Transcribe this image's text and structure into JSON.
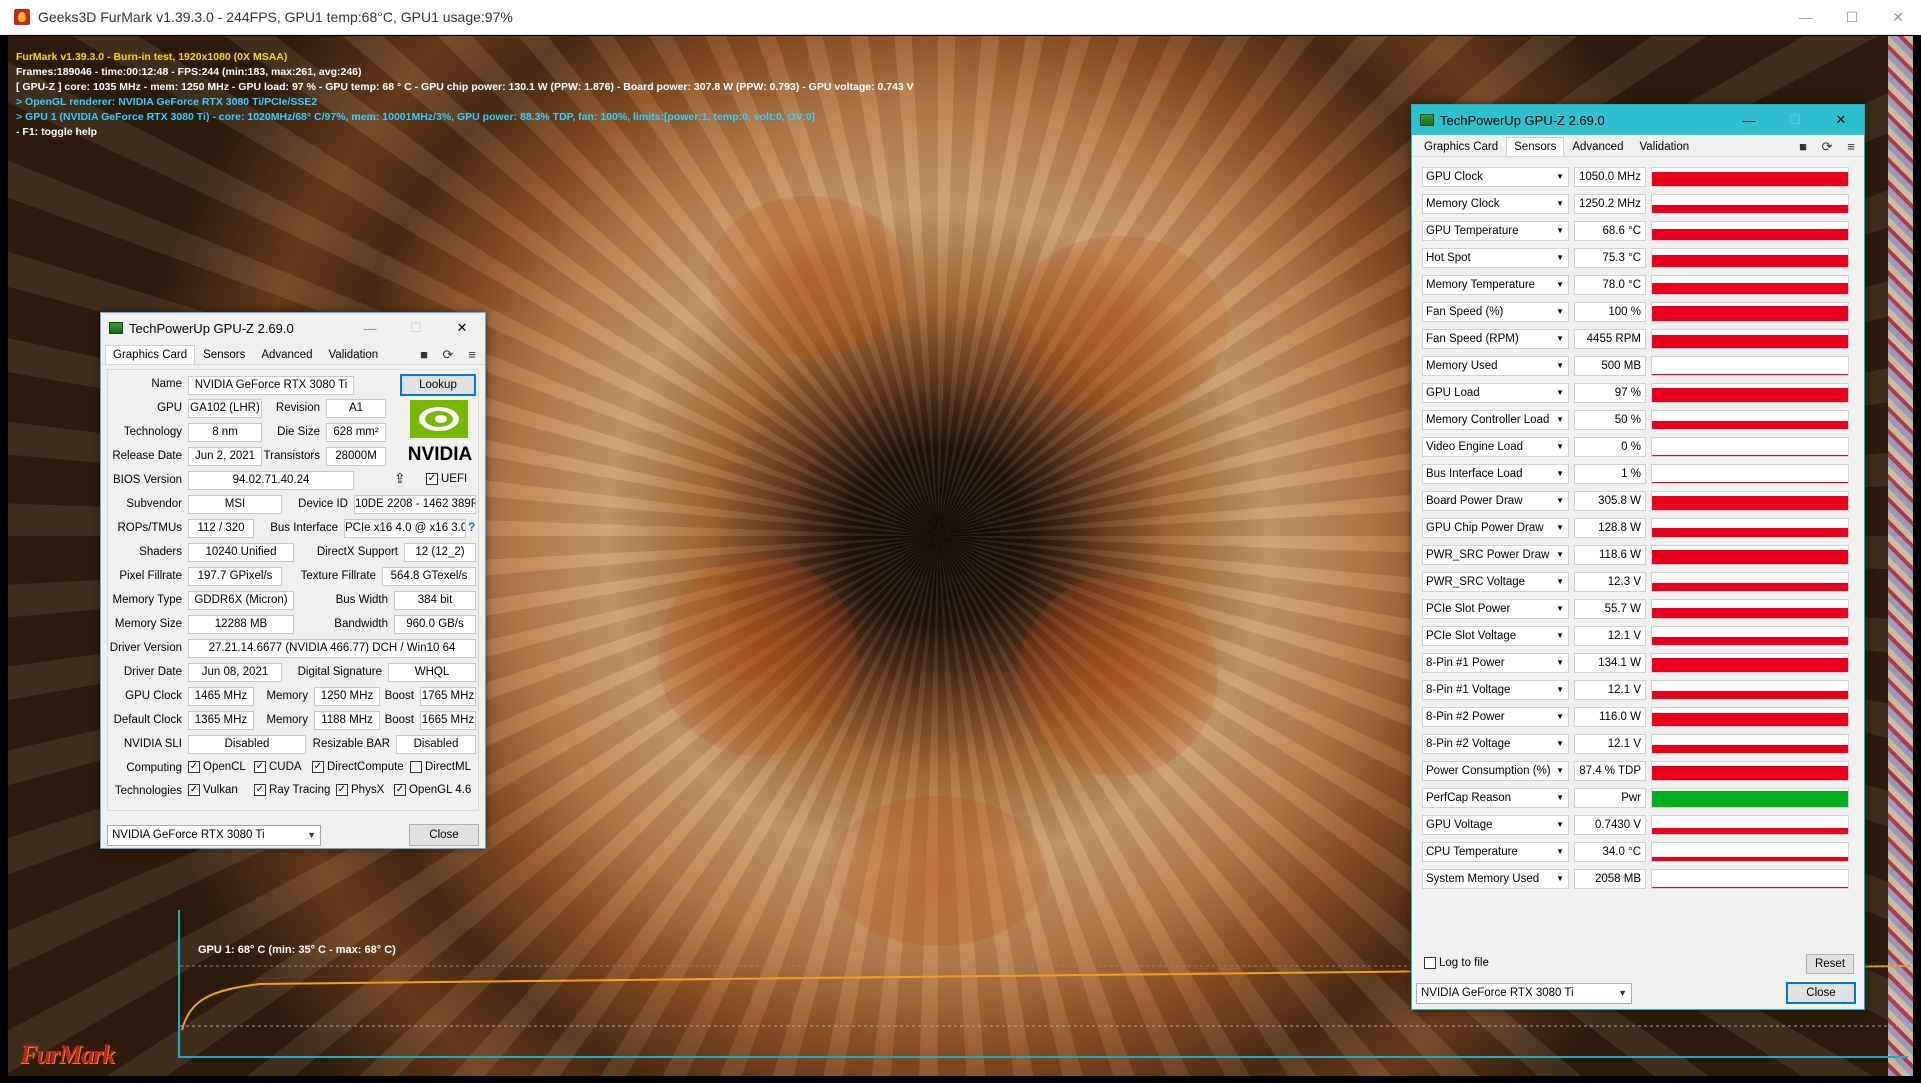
{
  "furmark": {
    "window_title": "Geeks3D FurMark v1.39.3.0 - 244FPS, GPU1 temp:68°C, GPU1 usage:97%",
    "osd": [
      "FurMark v1.39.3.0 - Burn-in test, 1920x1080 (0X MSAA)",
      "Frames:189046 - time:00:12:48 - FPS:244 (min:183, max:261, avg:246)",
      "[ GPU-Z ] core: 1035 MHz - mem: 1250 MHz - GPU load: 97 % - GPU temp: 68 ° C - GPU chip power: 130.1 W (PPW: 1.876) - Board power: 307.8 W (PPW: 0.793) - GPU voltage: 0.743 V",
      "> OpenGL renderer: NVIDIA GeForce RTX 3080 Ti/PCIe/SSE2",
      "> GPU 1 (NVIDIA GeForce RTX 3080 Ti) - core: 1020MHz/68° C/97%, mem: 10001MHz/3%, GPU power: 88.3% TDP, fan: 100%, limits:[power:1, temp:0, volt:0, OV:0]",
      "- F1: toggle help"
    ],
    "graph_label": "GPU 1: 68° C (min: 35° C - max: 68° C)",
    "logo_text": "FurMark"
  },
  "gpuz_card": {
    "title": "TechPowerUp GPU-Z 2.69.0",
    "tabs": [
      "Graphics Card",
      "Sensors",
      "Advanced",
      "Validation"
    ],
    "labels": {
      "name": "Name",
      "gpu": "GPU",
      "revision": "Revision",
      "technology": "Technology",
      "die_size": "Die Size",
      "release_date": "Release Date",
      "transistors": "Transistors",
      "bios_version": "BIOS Version",
      "subvendor": "Subvendor",
      "device_id": "Device ID",
      "rops_tmus": "ROPs/TMUs",
      "bus_interface": "Bus Interface",
      "shaders": "Shaders",
      "directx_support": "DirectX Support",
      "pixel_fillrate": "Pixel Fillrate",
      "texture_fillrate": "Texture Fillrate",
      "memory_type": "Memory Type",
      "bus_width": "Bus Width",
      "memory_size": "Memory Size",
      "bandwidth": "Bandwidth",
      "driver_version": "Driver Version",
      "driver_date": "Driver Date",
      "digital_signature": "Digital Signature",
      "gpu_clock": "GPU Clock",
      "memory": "Memory",
      "boost": "Boost",
      "default_clock": "Default Clock",
      "nvidia_sli": "NVIDIA SLI",
      "resizable_bar": "Resizable BAR",
      "computing": "Computing",
      "technologies": "Technologies"
    },
    "values": {
      "name": "NVIDIA GeForce RTX 3080 Ti",
      "gpu": "GA102 (LHR)",
      "revision": "A1",
      "technology": "8 nm",
      "die_size": "628 mm²",
      "release_date": "Jun 2, 2021",
      "transistors": "28000M",
      "bios_version": "94.02.71.40.24",
      "subvendor": "MSI",
      "device_id": "10DE 2208 - 1462 389F",
      "rops_tmus": "112 / 320",
      "bus_interface": "PCIe x16 4.0 @ x16 3.0",
      "shaders": "10240 Unified",
      "directx_support": "12 (12_2)",
      "pixel_fillrate": "197.7 GPixel/s",
      "texture_fillrate": "564.8 GTexel/s",
      "memory_type": "GDDR6X (Micron)",
      "bus_width": "384 bit",
      "memory_size": "12288 MB",
      "bandwidth": "960.0 GB/s",
      "driver_version": "27.21.14.6677 (NVIDIA 466.77) DCH / Win10 64",
      "driver_date": "Jun 08, 2021",
      "digital_signature": "WHQL",
      "gpu_clock": "1465 MHz",
      "gpu_memory": "1250 MHz",
      "gpu_boost": "1765 MHz",
      "default_clock": "1365 MHz",
      "default_memory": "1188 MHz",
      "default_boost": "1665 MHz",
      "nvidia_sli": "Disabled",
      "resizable_bar": "Disabled"
    },
    "uefi_label": "UEFI",
    "lookup_label": "Lookup",
    "help_glyph": "?",
    "logo_text": "NVIDIA",
    "computing": [
      "OpenCL",
      "CUDA",
      "DirectCompute",
      "DirectML"
    ],
    "computing_checked": [
      true,
      true,
      true,
      false
    ],
    "technologies": [
      "Vulkan",
      "Ray Tracing",
      "PhysX",
      "OpenGL 4.6"
    ],
    "technologies_checked": [
      true,
      true,
      true,
      true
    ],
    "device_select": "NVIDIA GeForce RTX 3080 Ti",
    "close_label": "Close"
  },
  "gpuz_sensors": {
    "title": "TechPowerUp GPU-Z 2.69.0",
    "tabs": [
      "Graphics Card",
      "Sensors",
      "Advanced",
      "Validation"
    ],
    "active_tab": "Sensors",
    "sensors": [
      {
        "name": "GPU Clock",
        "value": "1050.0 MHz",
        "level": 0.75,
        "color": "#e8001c"
      },
      {
        "name": "Memory Clock",
        "value": "1250.2 MHz",
        "level": 0.45,
        "color": "#e8001c"
      },
      {
        "name": "GPU Temperature",
        "value": "68.6 °C",
        "level": 0.6,
        "color": "#e8001c"
      },
      {
        "name": "Hot Spot",
        "value": "75.3 °C",
        "level": 0.65,
        "color": "#e8001c"
      },
      {
        "name": "Memory Temperature",
        "value": "78.0 °C",
        "level": 0.6,
        "color": "#e8001c"
      },
      {
        "name": "Fan Speed (%)",
        "value": "100 %",
        "level": 0.85,
        "color": "#e8001c"
      },
      {
        "name": "Fan Speed (RPM)",
        "value": "4455 RPM",
        "level": 0.7,
        "color": "#e8001c"
      },
      {
        "name": "Memory Used",
        "value": "500 MB",
        "level": 0.08,
        "color": "#e8001c"
      },
      {
        "name": "GPU Load",
        "value": "97 %",
        "level": 0.8,
        "color": "#e8001c"
      },
      {
        "name": "Memory Controller Load",
        "value": "50 %",
        "level": 0.45,
        "color": "#e8001c"
      },
      {
        "name": "Video Engine Load",
        "value": "0 %",
        "level": 0.0,
        "color": "#e8001c"
      },
      {
        "name": "Bus Interface Load",
        "value": "1 %",
        "level": 0.03,
        "color": "#e8001c"
      },
      {
        "name": "Board Power Draw",
        "value": "305.8 W",
        "level": 0.75,
        "color": "#e8001c"
      },
      {
        "name": "GPU Chip Power Draw",
        "value": "128.8 W",
        "level": 0.5,
        "color": "#e8001c"
      },
      {
        "name": "PWR_SRC Power Draw",
        "value": "118.6 W",
        "level": 0.8,
        "color": "#e8001c"
      },
      {
        "name": "PWR_SRC Voltage",
        "value": "12.3 V",
        "level": 0.45,
        "color": "#e8001c"
      },
      {
        "name": "PCIe Slot Power",
        "value": "55.7 W",
        "level": 0.55,
        "color": "#e8001c"
      },
      {
        "name": "PCIe Slot Voltage",
        "value": "12.1 V",
        "level": 0.45,
        "color": "#e8001c"
      },
      {
        "name": "8-Pin #1 Power",
        "value": "134.1 W",
        "level": 0.75,
        "color": "#e8001c"
      },
      {
        "name": "8-Pin #1 Voltage",
        "value": "12.1 V",
        "level": 0.45,
        "color": "#e8001c"
      },
      {
        "name": "8-Pin #2 Power",
        "value": "116.0 W",
        "level": 0.7,
        "color": "#e8001c"
      },
      {
        "name": "8-Pin #2 Voltage",
        "value": "12.1 V",
        "level": 0.45,
        "color": "#e8001c"
      },
      {
        "name": "Power Consumption (%)",
        "value": "87.4 % TDP",
        "level": 0.75,
        "color": "#e8001c"
      },
      {
        "name": "PerfCap Reason",
        "value": "Pwr",
        "level": 0.9,
        "color": "#00b020"
      },
      {
        "name": "GPU Voltage",
        "value": "0.7430 V",
        "level": 0.35,
        "color": "#e8001c"
      },
      {
        "name": "CPU Temperature",
        "value": "34.0 °C",
        "level": 0.2,
        "color": "#e8001c"
      },
      {
        "name": "System Memory Used",
        "value": "2058 MB",
        "level": 0.06,
        "color": "#e8001c"
      }
    ],
    "log_to_file": "Log to file",
    "reset_label": "Reset",
    "device_select": "NVIDIA GeForce RTX 3080 Ti",
    "close_label": "Close"
  },
  "icons": {
    "minimize": "—",
    "maximize": "☐",
    "close": "✕",
    "camera": "📷",
    "refresh": "⟳",
    "menu": "≡",
    "dropdown": "▼",
    "check": "✓",
    "share": "⇪"
  }
}
